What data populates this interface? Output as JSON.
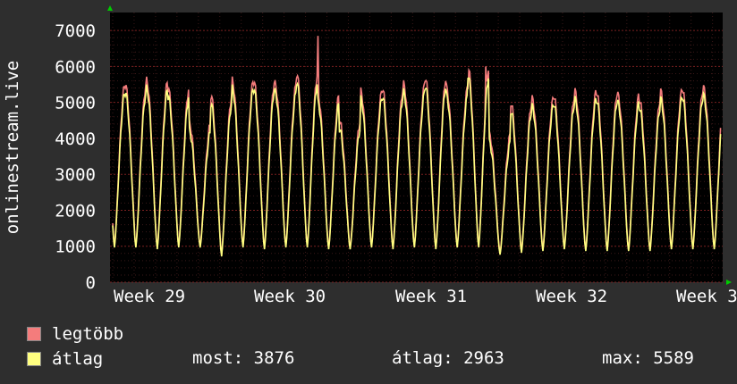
{
  "chart_data": {
    "type": "line",
    "ylabel": "onlinestream.live",
    "y_ticks": [
      "0",
      "1000",
      "2000",
      "3000",
      "4000",
      "5000",
      "6000",
      "7000"
    ],
    "ylim": [
      0,
      7500
    ],
    "x_ticks": [
      "Week 29",
      "Week 30",
      "Week 31",
      "Week 32",
      "Week 3"
    ],
    "grid": true,
    "series": [
      {
        "name": "legtöbb",
        "color": "#f47c7c",
        "description": "daily peak, ~28 cycles",
        "peaks": [
          5500,
          5500,
          5600,
          5400,
          4400,
          5200,
          5600,
          5600,
          5500,
          5800,
          5200,
          4500,
          5300,
          5400,
          5500,
          5700,
          5400,
          6000,
          4100,
          5000,
          5100,
          5200,
          5300,
          5300,
          5200,
          5100,
          5300,
          5400,
          5400
        ],
        "troughs": [
          1000,
          1000,
          950,
          1000,
          1000,
          750,
          1000,
          950,
          1000,
          1000,
          950,
          950,
          1000,
          950,
          1000,
          950,
          1000,
          1000,
          800,
          850,
          900,
          950,
          900,
          900,
          900,
          900,
          950,
          950,
          950
        ],
        "spikes": [
          [
            9.6,
            6850
          ],
          [
            17.4,
            6000
          ],
          [
            16.6,
            5400
          ]
        ]
      },
      {
        "name": "átlag",
        "color": "#ffff80",
        "description": "daily average"
      }
    ]
  },
  "legend": {
    "max_label": "legtöbb",
    "avg_label": "átlag",
    "max_color": "#f47c7c",
    "avg_color": "#ffff80"
  },
  "stats": {
    "most": "most: 3876",
    "atlag": "átlag: 2963",
    "max": "max: 5589"
  }
}
